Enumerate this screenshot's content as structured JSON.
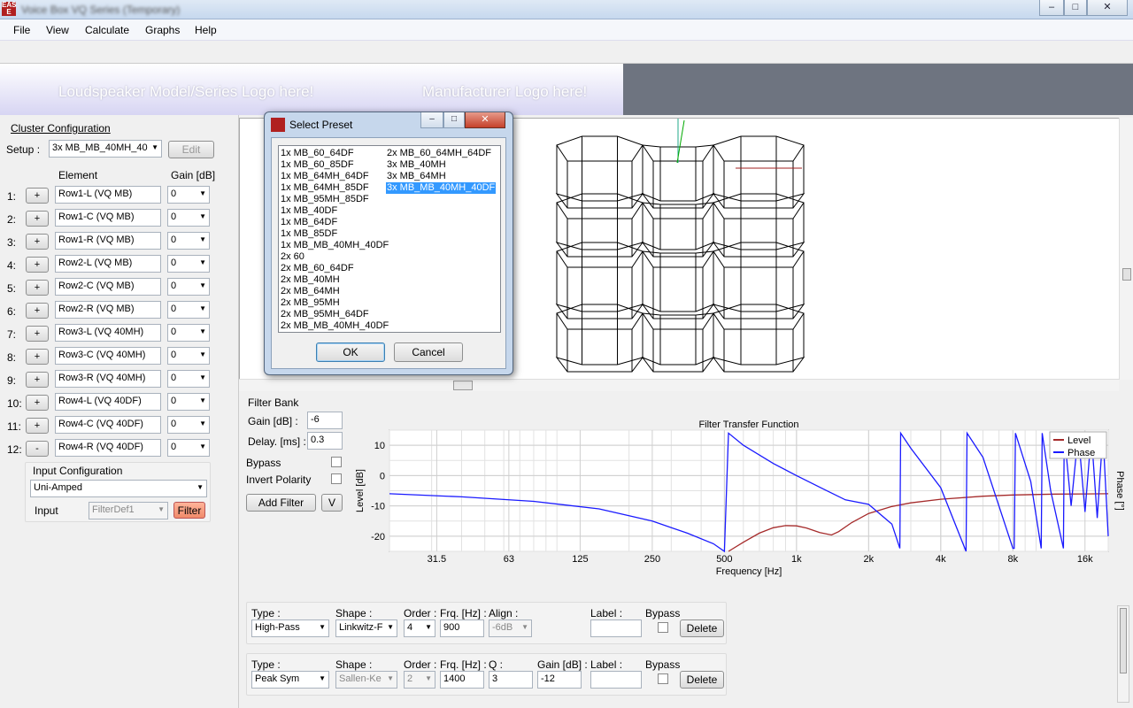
{
  "window": {
    "title": "Voice Box VQ Series (Temporary)",
    "min": "–",
    "max": "□",
    "close": "✕"
  },
  "menu": [
    "File",
    "View",
    "Calculate",
    "Graphs",
    "Help"
  ],
  "banner": {
    "model_logo": "Loudspeaker Model/Series Logo here!",
    "manufacturer_logo": "Manufacturer Logo here!"
  },
  "cluster": {
    "heading": "Cluster Configuration",
    "setup_label": "Setup :",
    "setup_value": "3x MB_MB_40MH_40",
    "edit": "Edit",
    "col_element": "Element",
    "col_gain": "Gain [dB]",
    "rows": [
      {
        "n": "1:",
        "btn": "+",
        "name": "Row1-L (VQ MB)",
        "gain": "0"
      },
      {
        "n": "2:",
        "btn": "+",
        "name": "Row1-C (VQ MB)",
        "gain": "0"
      },
      {
        "n": "3:",
        "btn": "+",
        "name": "Row1-R (VQ MB)",
        "gain": "0"
      },
      {
        "n": "4:",
        "btn": "+",
        "name": "Row2-L (VQ MB)",
        "gain": "0"
      },
      {
        "n": "5:",
        "btn": "+",
        "name": "Row2-C (VQ MB)",
        "gain": "0"
      },
      {
        "n": "6:",
        "btn": "+",
        "name": "Row2-R (VQ MB)",
        "gain": "0"
      },
      {
        "n": "7:",
        "btn": "+",
        "name": "Row3-L (VQ 40MH)",
        "gain": "0"
      },
      {
        "n": "8:",
        "btn": "+",
        "name": "Row3-C (VQ 40MH)",
        "gain": "0"
      },
      {
        "n": "9:",
        "btn": "+",
        "name": "Row3-R (VQ 40MH)",
        "gain": "0"
      },
      {
        "n": "10:",
        "btn": "+",
        "name": "Row4-L (VQ 40DF)",
        "gain": "0"
      },
      {
        "n": "11:",
        "btn": "+",
        "name": "Row4-C (VQ 40DF)",
        "gain": "0"
      },
      {
        "n": "12:",
        "btn": "-",
        "name": "Row4-R (VQ 40DF)",
        "gain": "0"
      }
    ]
  },
  "input_config": {
    "heading": "Input Configuration",
    "mode": "Uni-Amped",
    "input_label": "Input",
    "input_value": "FilterDef1",
    "filter_btn": "Filter"
  },
  "dialog": {
    "title": "Select Preset",
    "ok": "OK",
    "cancel": "Cancel",
    "col1": [
      "1x MB_60_64DF",
      "1x MB_60_85DF",
      "1x MB_64MH_64DF",
      "1x MB_64MH_85DF",
      "1x MB_95MH_85DF",
      "1x MB_40DF",
      "1x MB_64DF",
      "1x MB_85DF",
      "1x MB_MB_40MH_40DF",
      "2x 60",
      "2x MB_60_64DF",
      "2x MB_40MH",
      "2x MB_64MH",
      "2x MB_95MH",
      "2x MB_95MH_64DF",
      "2x MB_MB_40MH_40DF"
    ],
    "col2": [
      "2x MB_60_64MH_64DF",
      "3x MB_40MH",
      "3x MB_64MH",
      "3x MB_MB_40MH_40DF"
    ],
    "selected": "3x MB_MB_40MH_40DF"
  },
  "filterbank": {
    "heading": "Filter Bank",
    "gain_label": "Gain [dB] :",
    "gain": "-6",
    "delay_label": "Delay. [ms] :",
    "delay": "0.3",
    "bypass": "Bypass",
    "invert": "Invert Polarity",
    "add_filter": "Add Filter",
    "v_btn": "V"
  },
  "chart_data": {
    "type": "line",
    "title": "Filter Transfer Function",
    "xlabel": "Frequency [Hz]",
    "ylabel": "Level [dB]",
    "y2label": "Phase [°]",
    "xscale": "log",
    "xlim": [
      20,
      20000
    ],
    "ylim": [
      -25,
      15
    ],
    "xticks": [
      "31.5",
      "63",
      "125",
      "250",
      "500",
      "1k",
      "2k",
      "4k",
      "8k",
      "16k"
    ],
    "xtick_values": [
      31.5,
      63,
      125,
      250,
      500,
      1000,
      2000,
      4000,
      8000,
      16000
    ],
    "yticks": [
      "10",
      "0",
      "-10",
      "-20"
    ],
    "ytick_values": [
      10,
      0,
      -10,
      -20
    ],
    "legend": [
      "Level",
      "Phase"
    ],
    "legend_position": "top-right",
    "colors": {
      "level": "#a52a2a",
      "phase": "#1a1aff"
    },
    "series": [
      {
        "name": "Level",
        "x": [
          520,
          600,
          700,
          800,
          900,
          1000,
          1100,
          1250,
          1400,
          1500,
          1700,
          2000,
          2500,
          3000,
          4000,
          6000,
          8000,
          12000,
          16000,
          20000
        ],
        "y": [
          -25,
          -22,
          -19,
          -17.2,
          -16.5,
          -16.6,
          -17.3,
          -18.8,
          -19.6,
          -18.5,
          -15.5,
          -12.5,
          -10.2,
          -9,
          -7.8,
          -6.8,
          -6.4,
          -6.1,
          -6.05,
          -6
        ]
      },
      {
        "name": "Phase",
        "x": [
          20,
          40,
          80,
          150,
          250,
          350,
          450,
          500,
          520,
          600,
          800,
          1000,
          1300,
          1600,
          2000,
          2500,
          2700,
          2720,
          3000,
          4000,
          5100,
          5150,
          6000,
          8000,
          8100,
          8200,
          9500,
          10500,
          10600,
          11500,
          13000,
          13100,
          14000,
          15000,
          16000,
          17000,
          18000,
          19000,
          20000
        ],
        "y": [
          -6,
          -7,
          -8.5,
          -11,
          -15,
          -19,
          -22.5,
          -25,
          14,
          10,
          4,
          0,
          -4.5,
          -8,
          -9.5,
          -16,
          -24,
          14,
          9,
          -4,
          -25,
          14,
          6,
          -24,
          -24,
          14,
          -2,
          -24,
          14,
          -5,
          -24,
          14,
          -10,
          14,
          -12,
          14,
          -14,
          14,
          -20
        ]
      }
    ]
  },
  "filters": [
    {
      "type_label": "Type :",
      "type": "High-Pass",
      "shape_label": "Shape :",
      "shape": "Linkwitz-F",
      "order_label": "Order :",
      "order": "4",
      "frq_label": "Frq. [Hz] :",
      "frq": "900",
      "align_label": "Align :",
      "align": "-6dB",
      "label_label": "Label :",
      "bypass": "Bypass",
      "delete": "Delete"
    },
    {
      "type_label": "Type :",
      "type": "Peak Sym",
      "shape_label": "Shape :",
      "shape": "Sallen-Ke",
      "order_label": "Order :",
      "order": "2",
      "frq_label": "Frq. [Hz] :",
      "frq": "1400",
      "q_label": "Q :",
      "q": "3",
      "gain_label": "Gain [dB] :",
      "gain": "-12",
      "label_label": "Label :",
      "bypass": "Bypass",
      "delete": "Delete"
    }
  ]
}
